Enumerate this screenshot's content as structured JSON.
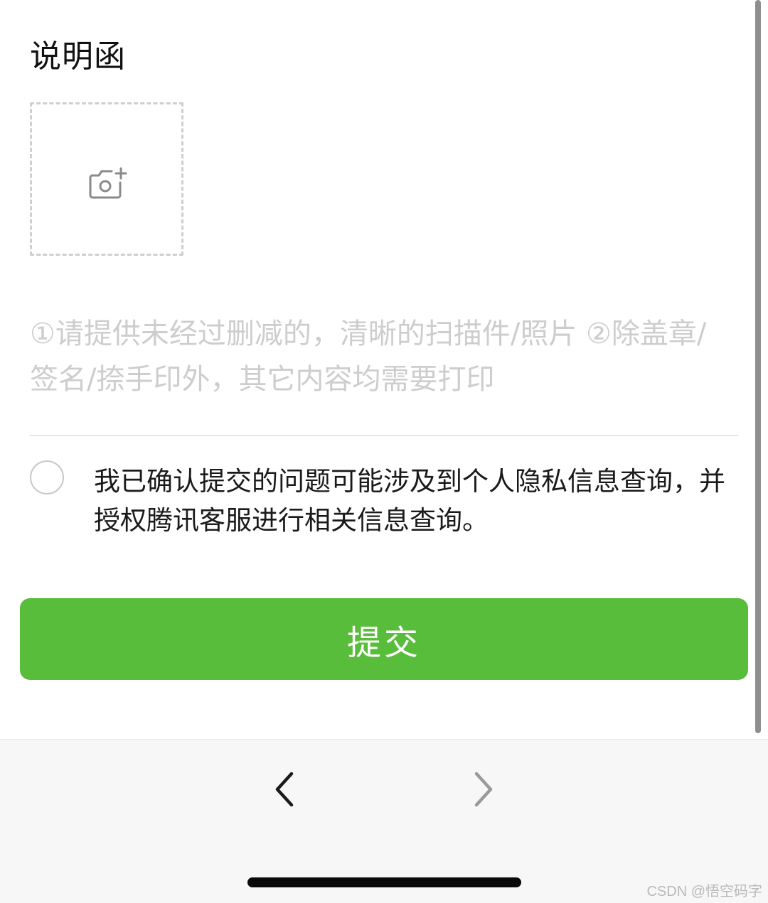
{
  "form": {
    "section_title": "说明函",
    "upload_hint": "①请提供未经过删减的，清晰的扫描件/照片 ②除盖章/签名/捺手印外，其它内容均需要打印",
    "consent_text": "我已确认提交的问题可能涉及到个人隐私信息查询，并授权腾讯客服进行相关信息查询。",
    "consent_checked": false,
    "submit_label": "提交"
  },
  "icons": {
    "upload": "camera-add-icon",
    "back": "chevron-left-icon",
    "forward": "chevron-right-icon"
  },
  "colors": {
    "primary": "#58bd3a",
    "hint": "#cdcdcd",
    "border_dashed": "#cfcfcf",
    "nav_bar": "#f7f7f7"
  },
  "watermark": "CSDN @悟空码字"
}
